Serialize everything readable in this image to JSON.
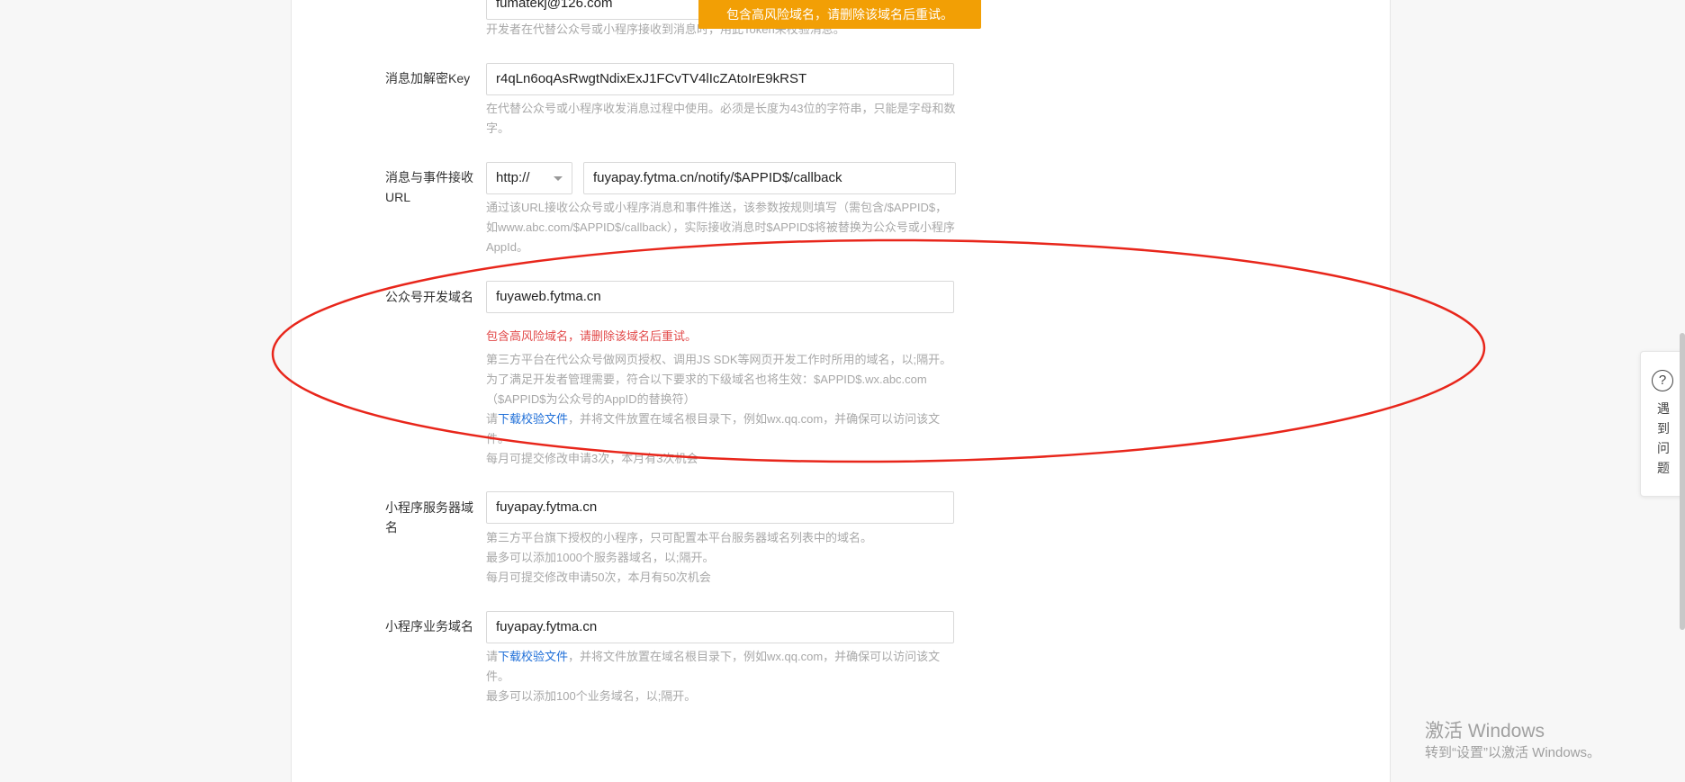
{
  "toast": {
    "text": "包含高风险域名，请删除该域名后重试。"
  },
  "token": {
    "value": "fumatekj@126.com",
    "hint": "开发者在代替公众号或小程序接收到消息时，用此Token来校验消息。"
  },
  "aes_key": {
    "label": "消息加解密Key",
    "value": "r4qLn6oqAsRwgtNdixExJ1FCvTV4lIcZAtoIrE9kRST",
    "hint": "在代替公众号或小程序收发消息过程中使用。必须是长度为43位的字符串，只能是字母和数字。"
  },
  "callback_url": {
    "label": "消息与事件接收URL",
    "protocol": "http://",
    "value": "fuyapay.fytma.cn/notify/$APPID$/callback",
    "hint": "通过该URL接收公众号或小程序消息和事件推送，该参数按规则填写（需包含/$APPID$，如www.abc.com/$APPID$/callback），实际接收消息时$APPID$将被替换为公众号或小程序AppId。"
  },
  "oa_domain": {
    "label": "公众号开发域名",
    "value": "fuyaweb.fytma.cn",
    "error": "包含高风险域名，请删除该域名后重试。",
    "hint1": "第三方平台在代公众号做网页授权、调用JS SDK等网页开发工作时所用的域名，以;隔开。为了满足开发者管理需要，符合以下要求的下级域名也将生效：$APPID$.wx.abc.com（$APPID$为公众号的AppID的替换符）",
    "hint2_prefix": "请",
    "hint2_link": "下载校验文件",
    "hint2_suffix": "，并将文件放置在域名根目录下，例如wx.qq.com，并确保可以访问该文件。",
    "hint3": "每月可提交修改申请3次，本月有3次机会"
  },
  "mp_server_domain": {
    "label": "小程序服务器域名",
    "value": "fuyapay.fytma.cn",
    "hint1": "第三方平台旗下授权的小程序，只可配置本平台服务器域名列表中的域名。",
    "hint2": "最多可以添加1000个服务器域名，以;隔开。",
    "hint3": "每月可提交修改申请50次，本月有50次机会"
  },
  "mp_business_domain": {
    "label": "小程序业务域名",
    "value": "fuyapay.fytma.cn",
    "hint1_prefix": "请",
    "hint1_link": "下载校验文件",
    "hint1_suffix": "，并将文件放置在域名根目录下，例如wx.qq.com，并确保可以访问该文件。",
    "hint2": "最多可以添加100个业务域名，以;隔开。"
  },
  "help_widget": {
    "icon": "question-icon",
    "label": "遇到问题"
  },
  "watermark": {
    "line1": "激活 Windows",
    "line2": "转到“设置”以激活 Windows。"
  },
  "colors": {
    "toast": "#f29f05",
    "error": "#e24a4a",
    "link": "#1f6fd8",
    "annotation": "#e8261b"
  }
}
